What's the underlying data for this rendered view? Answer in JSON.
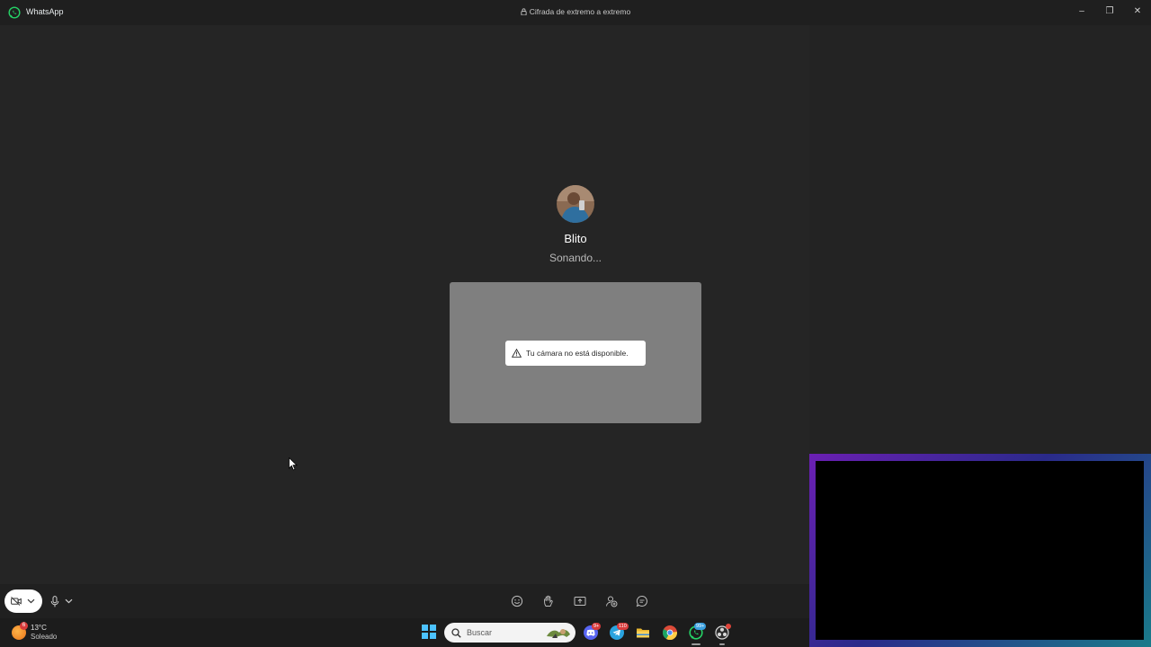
{
  "window": {
    "app_name": "WhatsApp",
    "encryption_label": "Cifrada de extremo a extremo",
    "controls": {
      "minimize": "–",
      "restore": "❐",
      "close": "✕"
    }
  },
  "call": {
    "caller_name": "Blito",
    "status": "Sonando...",
    "camera_warning": "Tu cámara no está disponible."
  },
  "controls": {
    "icons": [
      "camera-off-icon",
      "chevron-down-icon",
      "microphone-icon",
      "emoji-icon",
      "raise-hand-icon",
      "share-screen-icon",
      "add-participant-icon",
      "chat-icon"
    ]
  },
  "taskbar": {
    "weather_temp": "13°C",
    "weather_desc": "Soleado",
    "weather_badge": "6",
    "search_placeholder": "Buscar",
    "badges": {
      "discord": "9+",
      "telegram": "110",
      "whatsapp": "99+"
    }
  },
  "colors": {
    "accent_green": "#25d366",
    "background": "#252525",
    "preview": "#7f7f7f",
    "start_blue": "#4cc2ff"
  }
}
